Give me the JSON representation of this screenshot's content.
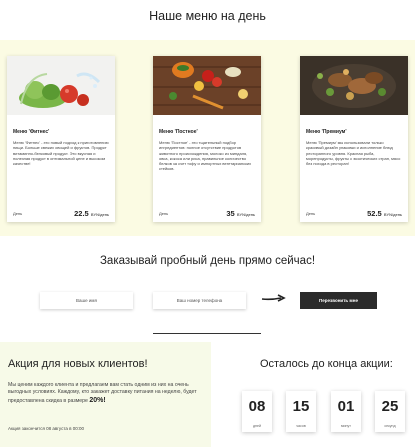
{
  "menu_section": {
    "title": "Наше меню на день",
    "cards": [
      {
        "title": "Меню 'Фитнес'",
        "description": "Меню 'Фитнес' - это новый подход к приготовлению пищи. Больше свежих овощей и фруктов. Продукт витаминно-белковый продукт. Это вкусная и полезная продукт в оптимальной цене и высоком качестве!",
        "days_label": "День",
        "price": "22.5",
        "price_unit": "BYN/день",
        "photo_icon": "salad-photo-icon"
      },
      {
        "title": "Меню 'Постное'",
        "description": "Меню 'Постное' - это тщательный подбор ингредиентов: полное отсутствие продуктов животного происхождения, молоко из миндаля, овса, кокоса или риса, правильное количество белков за счет тофу и импортных вегетарианских стейков.",
        "days_label": "День",
        "price": "35",
        "price_unit": "BYN/день",
        "photo_icon": "vegetables-photo-icon"
      },
      {
        "title": "Меню 'Премиум'",
        "description": "Меню 'Премиум' мы использовали только красивый дизайн упаковки и исполнение блюд ресторанного уровня. Красная рыба, морепродукты, фрукты с экзотических стран, мясо без похода в ресторан!",
        "days_label": "День",
        "price": "52.5",
        "price_unit": "BYN/день",
        "photo_icon": "meat-dish-photo-icon"
      }
    ]
  },
  "order_section": {
    "title": "Заказывай пробный день прямо сейчас!",
    "name_placeholder": "Ваше имя",
    "phone_placeholder": "Ваш номер телефона",
    "button_label": "Перезвонить мне"
  },
  "promo": {
    "title": "Акция для новых клиентов!",
    "text_before": "Мы ценим каждого клиента и предлагаем вам стать одним из них на очень выгодных условиях. Каждому, кто закажет доставку питания на неделю, будет предоставлена скидка в размере",
    "discount": "20%!",
    "end_text": "Акция закончится 08 августа в 00:00"
  },
  "countdown": {
    "title": "Осталось до конца акции:",
    "units": [
      {
        "value": "08",
        "label": "дней"
      },
      {
        "value": "15",
        "label": "часов"
      },
      {
        "value": "01",
        "label": "минут"
      },
      {
        "value": "25",
        "label": "секунд"
      }
    ]
  },
  "colors": {
    "menu_band": "#fbfbe3",
    "promo_band": "#f7fae8",
    "button": "#2b2b2b"
  }
}
